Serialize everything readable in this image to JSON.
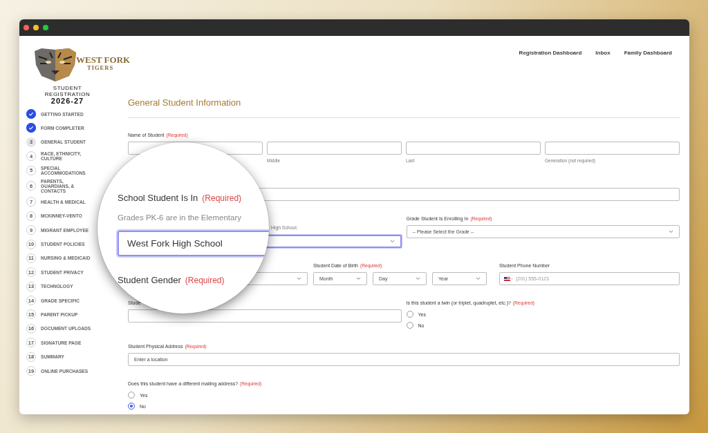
{
  "sidebar": {
    "logo": {
      "line1": "WEST FORK",
      "line2": "TIGERS"
    },
    "registration_title": [
      "STUDENT",
      "REGISTRATION",
      "2026-27"
    ],
    "steps": [
      {
        "label": "GETTING STARTED",
        "kind": "done"
      },
      {
        "label": "FORM COMPLETER",
        "kind": "done"
      },
      {
        "number": "3",
        "label": "GENERAL STUDENT",
        "kind": "current"
      },
      {
        "number": "4",
        "label": "RACE, ETHNICITY,\nCULTURE",
        "kind": "pending"
      },
      {
        "number": "5",
        "label": "SPECIAL\nACCOMMODATIONS",
        "kind": "pending"
      },
      {
        "number": "6",
        "label": "PARENTS,\nGUARDIANS, &\nCONTACTS",
        "kind": "pending"
      },
      {
        "number": "7",
        "label": "HEALTH & MEDICAL",
        "kind": "pending"
      },
      {
        "number": "8",
        "label": "MCKINNEY-VENTO",
        "kind": "pending"
      },
      {
        "number": "9",
        "label": "MIGRANT EMPLOYEE",
        "kind": "pending"
      },
      {
        "number": "10",
        "label": "STUDENT POLICIES",
        "kind": "pending"
      },
      {
        "number": "11",
        "label": "NURSING & MEDICAID",
        "kind": "pending"
      },
      {
        "number": "12",
        "label": "STUDENT PRIVACY",
        "kind": "pending"
      },
      {
        "number": "13",
        "label": "TECHNOLOGY",
        "kind": "pending"
      },
      {
        "number": "14",
        "label": "GRADE SPECIFIC",
        "kind": "pending"
      },
      {
        "number": "15",
        "label": "PARENT PICKUP",
        "kind": "pending"
      },
      {
        "number": "16",
        "label": "DOCUMENT UPLOADS",
        "kind": "pending"
      },
      {
        "number": "17",
        "label": "SIGNATURE PAGE",
        "kind": "pending"
      },
      {
        "number": "18",
        "label": "SUMMARY",
        "kind": "pending"
      },
      {
        "number": "19",
        "label": "ONLINE PURCHASES",
        "kind": "pending"
      }
    ]
  },
  "nav": [
    "Registration Dashboard",
    "Inbox",
    "Family Dashboard"
  ],
  "section_title": "General Student Information",
  "name_of_student": {
    "label": "Name of Student",
    "required": "(Required)",
    "sublabels": [
      "Middle",
      "Last",
      "Generation (not required)"
    ]
  },
  "school_field": {
    "hint": "High School.",
    "focused": true
  },
  "grade": {
    "label": "Grade Student Is Enrolling In",
    "required": "(Required)",
    "value": "-- Please Select the Grade --"
  },
  "date_of_birth": {
    "label": "Student Date of Birth",
    "required": "(Required)",
    "selects": [
      "Month",
      "Day",
      "Year"
    ]
  },
  "phone": {
    "label": "Student Phone Number",
    "placeholder": "(201) 555-0123"
  },
  "student_field": {
    "label": "Stude"
  },
  "twin": {
    "label": "Is this student a twin (or triplet, quadruplet, etc.)?",
    "required": "(Required)",
    "options": [
      {
        "label": "Yes",
        "selected": false
      },
      {
        "label": "No",
        "selected": false
      }
    ]
  },
  "address": {
    "label": "Student Physical Address",
    "required": "(Required)",
    "placeholder": "Enter a location"
  },
  "mailing": {
    "label": "Does this student have a different mailing address?",
    "required": "(Required)",
    "options": [
      {
        "label": "Yes",
        "selected": false
      },
      {
        "label": "No",
        "selected": true
      }
    ]
  },
  "magnifier": {
    "school_label": "School Student Is In",
    "school_required": "(Required)",
    "hint": "Grades PK-6 are in the Elementary",
    "school_value": "West Fork High School",
    "gender_label": "Student Gender",
    "gender_required": "(Required)"
  }
}
